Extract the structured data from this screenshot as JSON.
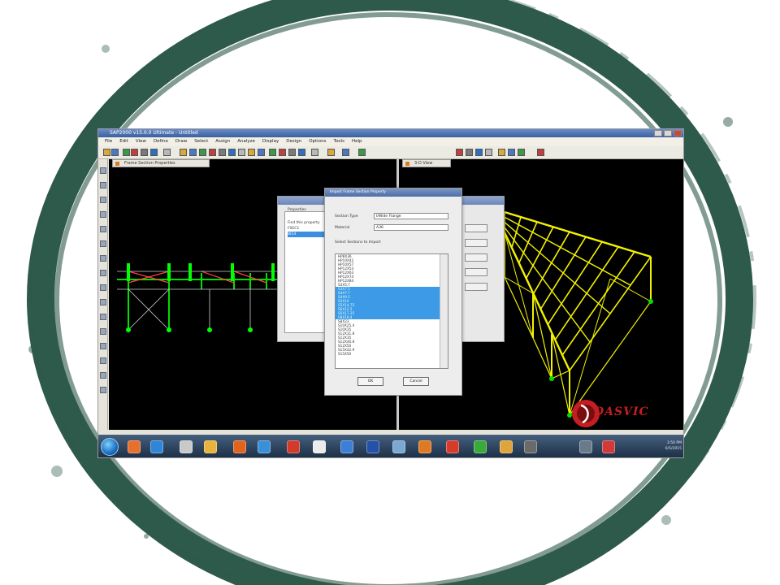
{
  "window": {
    "title": "SAP2000 v15.0.0 Ultimate - Untitled"
  },
  "menu": [
    "File",
    "Edit",
    "View",
    "Define",
    "Draw",
    "Select",
    "Assign",
    "Analyze",
    "Display",
    "Design",
    "Options",
    "Tools",
    "Help"
  ],
  "viewports": {
    "left_tab": "Frame Section Properties",
    "right_tab": "3-D View"
  },
  "dialog_back": {
    "labels": [
      "Properties",
      "Find this property"
    ],
    "items": [
      "FSEC1",
      "W14"
    ]
  },
  "dialog_front": {
    "title": "Import Frame Section Property",
    "section_type_label": "Section Type",
    "section_type_value": "I/Wide Flange",
    "material_label": "Material",
    "material_value": "A36",
    "list_label": "Select Sections to Import",
    "list_items": [
      "HP8X36",
      "HP10X42",
      "HP10X57",
      "HP12X53",
      "HP12X63",
      "HP12X74",
      "HP12X84",
      "S3X5.7",
      "S3X7.5",
      "S4X7.7",
      "S4X9.5",
      "S5X10",
      "S5X14.75",
      "S6X12.5",
      "S6X17.25",
      "S8X18.4",
      "S8X23",
      "S10X25.4",
      "S10X35",
      "S12X31.8",
      "S12X35",
      "S12X40.8",
      "S12X50",
      "S15X42.9",
      "S15X50"
    ],
    "selected_range": [
      8,
      15
    ],
    "ok_label": "OK",
    "cancel_label": "Cancel"
  },
  "tray": {
    "time": "3:50 PM",
    "date": "6/5/2015"
  },
  "watermark": {
    "text": "DASVIC"
  },
  "colors": {
    "frame_border": "#2e5a4b",
    "structure_yellow": "#f2f200",
    "accent_blue": "#3c9ae6",
    "logo_red": "#c31e22"
  }
}
